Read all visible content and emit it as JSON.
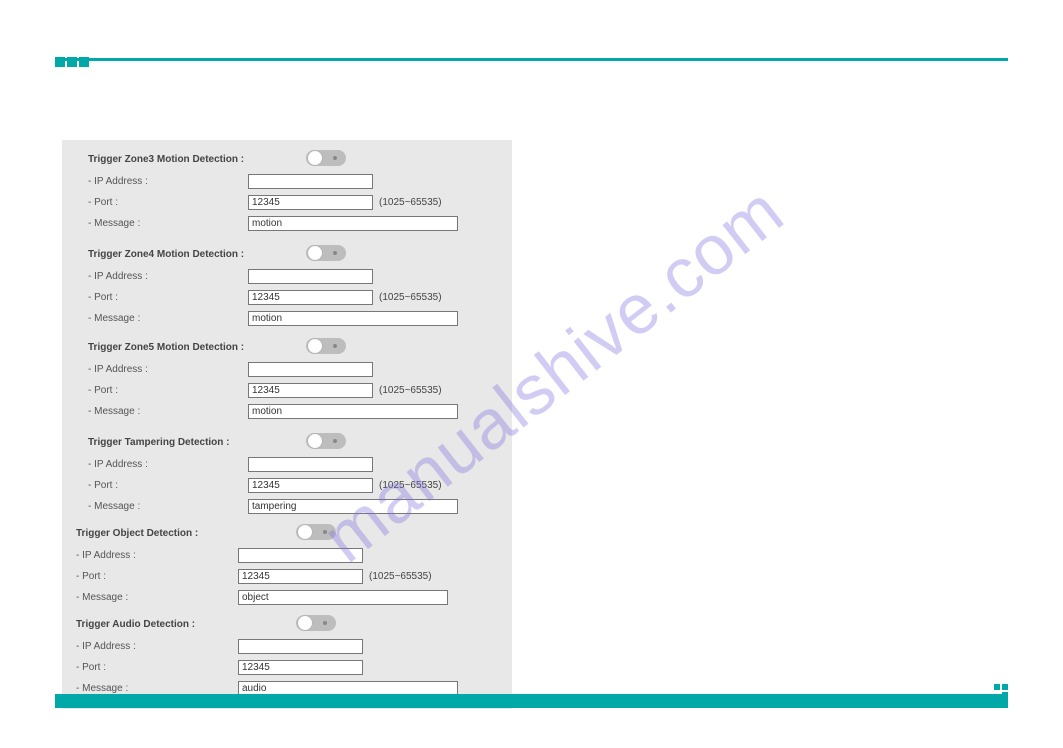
{
  "watermark": "manualshive.com",
  "port_hint": "(1025~65535)",
  "labels": {
    "ip": "- IP Address :",
    "port": "- Port :",
    "message": "- Message :"
  },
  "sections": {
    "zone3": {
      "title": "Trigger Zone3 Motion Detection :",
      "port": "12345",
      "message": "motion"
    },
    "zone4": {
      "title": "Trigger Zone4 Motion Detection :",
      "port": "12345",
      "message": "motion"
    },
    "zone5": {
      "title": "Trigger Zone5 Motion Detection :",
      "port": "12345",
      "message": "motion"
    },
    "tampering": {
      "title": "Trigger Tampering Detection :",
      "port": "12345",
      "message": "tampering"
    },
    "object": {
      "title": "Trigger Object Detection :",
      "port": "12345",
      "message": "object"
    },
    "audio": {
      "title": "Trigger Audio Detection :",
      "port": "12345",
      "message": "audio"
    }
  }
}
